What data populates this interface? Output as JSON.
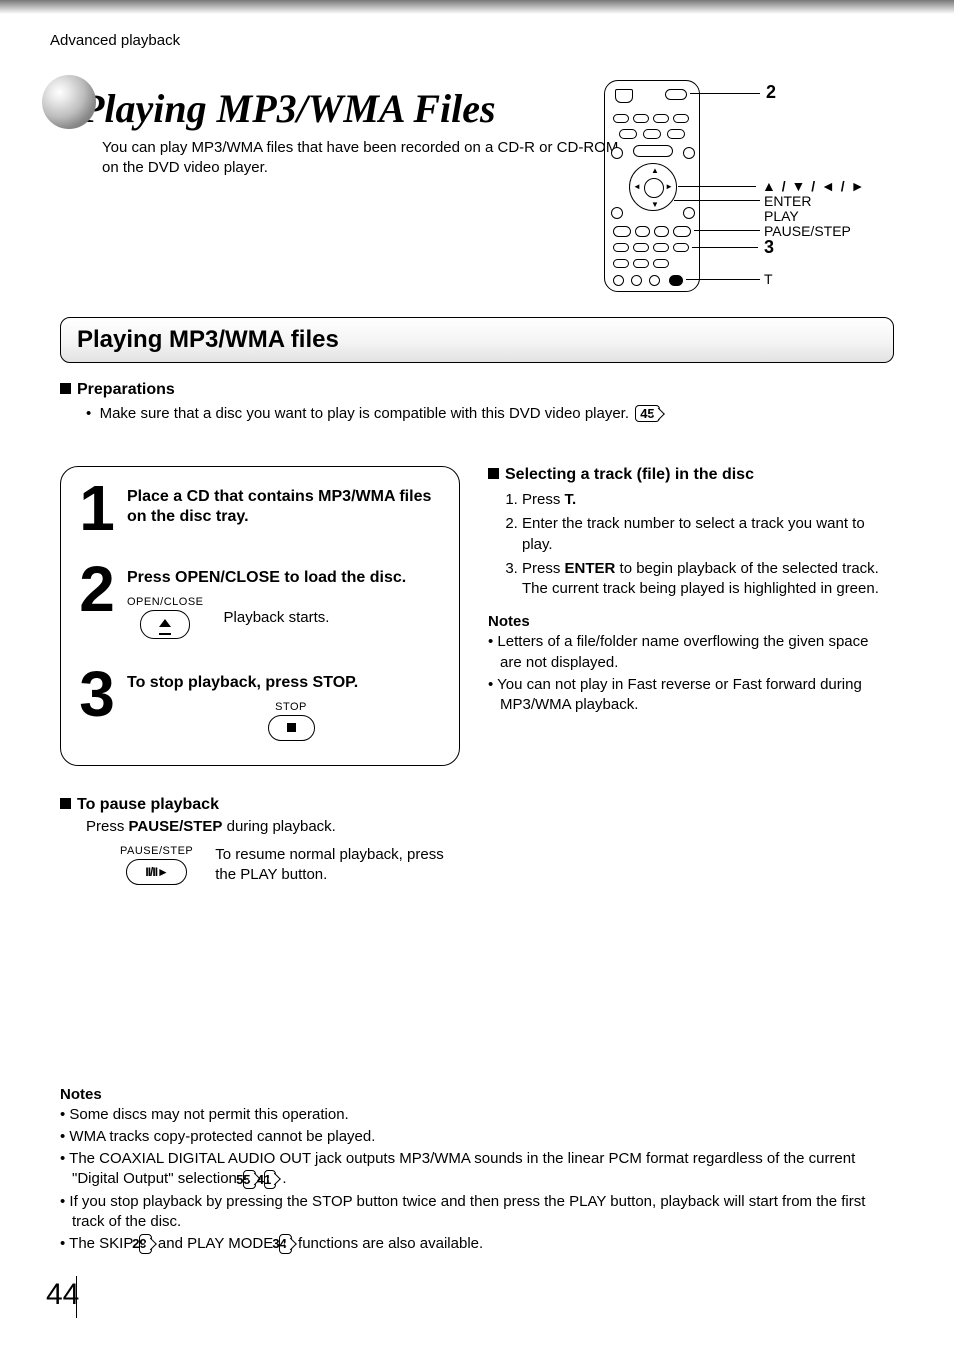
{
  "header": {
    "section": "Advanced playback"
  },
  "title": "Playing MP3/WMA Files",
  "intro": "You can play MP3/WMA files that have been recorded on a CD-R or CD-ROM on the DVD video player.",
  "remote": {
    "label2": "2",
    "arrows": "▲ / ▼ / ◄ / ►",
    "enter": "ENTER",
    "play": "PLAY",
    "pause": "PAUSE/STEP",
    "label3": "3",
    "t": "T"
  },
  "section_bar": "Playing MP3/WMA files",
  "preparations": {
    "heading": "Preparations",
    "bullet_pre": "Make sure that a disc you want to play is compatible with this DVD video player.",
    "ref": "45"
  },
  "steps": {
    "s1": {
      "num": "1",
      "title": "Place a CD that contains MP3/WMA files on the disc tray."
    },
    "s2": {
      "num": "2",
      "title": "Press OPEN/CLOSE to load the disc.",
      "btn_caption": "OPEN/CLOSE",
      "sub": "Playback starts."
    },
    "s3": {
      "num": "3",
      "title": "To stop playback, press STOP.",
      "btn_caption": "STOP"
    }
  },
  "selecting": {
    "heading": "Selecting a track (file) in the disc",
    "li1_a": "Press ",
    "li1_b": "T.",
    "li2": "Enter the track number to select a track you want to play.",
    "li3_a": "Press ",
    "li3_b": "ENTER",
    "li3_c": " to begin playback of the selected track.",
    "li3_d": "The current track being played is highlighted in green.",
    "notes_h": "Notes",
    "note1": "Letters of a file/folder name overflowing the given space are not displayed.",
    "note2": "You can not play in Fast reverse or Fast forward during MP3/WMA playback."
  },
  "pause": {
    "heading": "To pause playback",
    "line_a": "Press ",
    "line_b": "PAUSE/STEP",
    "line_c": " during playback.",
    "btn_caption": "PAUSE/STEP",
    "resume": "To resume normal playback, press the PLAY button."
  },
  "bottom_notes": {
    "heading": "Notes",
    "n1": "Some discs may not permit this operation.",
    "n2": "WMA tracks copy-protected cannot be played.",
    "n3_a": "The COAXIAL DIGITAL AUDIO OUT jack outputs MP3/WMA sounds in the linear PCM format regardless of the current \"Digital Output\" selection ",
    "ref55": "55",
    "ref41": "41",
    "n3_b": " .",
    "n4": "If you stop playback by pressing the STOP button twice and then press the PLAY button, playback will start from the first track of the disc.",
    "n5_a": "The SKIP ",
    "ref29": "29",
    "n5_b": " and PLAY MODE ",
    "ref34": "34",
    "n5_c": " functions are also available."
  },
  "page_number": "44"
}
